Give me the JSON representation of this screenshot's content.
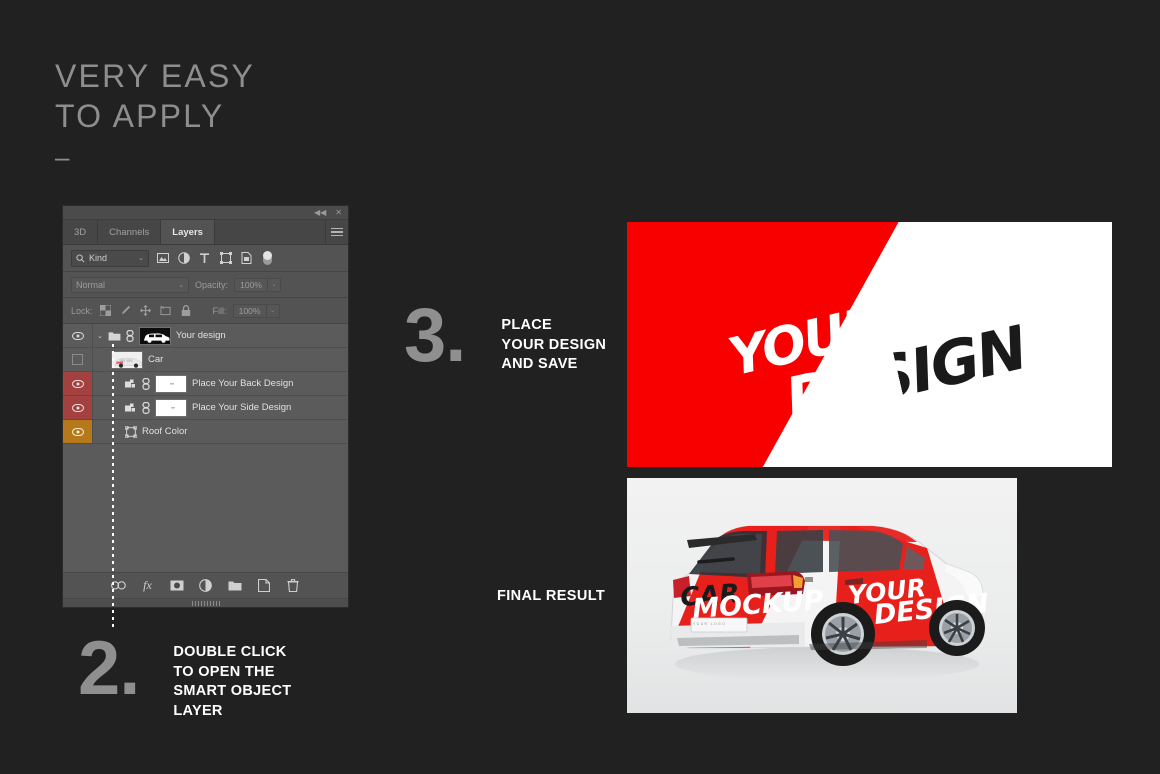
{
  "headline": {
    "line1": "VERY EASY",
    "line2": "TO APPLY",
    "dash": "–"
  },
  "photoshop_panel": {
    "titlebar": {
      "collapse": "◀◀",
      "close": "✕"
    },
    "tabs": [
      {
        "label": "3D",
        "active": false
      },
      {
        "label": "Channels",
        "active": false
      },
      {
        "label": "Layers",
        "active": true
      }
    ],
    "menu_icon": "hamburger-icon",
    "filter_row": {
      "kind_label": "Kind",
      "search_icon": "search-icon",
      "chevron": "⌄",
      "icons": [
        "image-filter-icon",
        "adjustment-filter-icon",
        "text-filter-icon",
        "shape-filter-icon",
        "smart-object-filter-icon",
        "filter-toggle-icon"
      ]
    },
    "blend_row": {
      "blend_mode": "Normal",
      "chevron": "⌄",
      "opacity_label": "Opacity:",
      "opacity_value": "100%"
    },
    "lock_row": {
      "lock_label": "Lock:",
      "icons": [
        "lock-transparent-icon",
        "lock-image-icon",
        "lock-position-icon",
        "lock-artboard-icon",
        "lock-all-icon"
      ],
      "fill_label": "Fill:",
      "fill_value": "100%"
    },
    "layers": [
      {
        "name": "Your design",
        "eye": "visible",
        "eye_style": "plain",
        "indent": 0,
        "has_chevron": true,
        "icon": "folder-icon",
        "has_link": true,
        "thumb": "car-silhouette-thumbnail"
      },
      {
        "name": "Car",
        "eye": "hidden",
        "eye_style": "empty",
        "indent": 1,
        "has_chevron": false,
        "icon": "",
        "has_link": false,
        "thumb": "car-photo-thumbnail"
      },
      {
        "name": "Place Your Back Design",
        "eye": "visible",
        "eye_style": "red",
        "indent": 2,
        "has_chevron": false,
        "icon": "smart-object-icon",
        "has_link": true,
        "thumb": "white-thumbnail"
      },
      {
        "name": "Place Your Side Design",
        "eye": "visible",
        "eye_style": "red",
        "indent": 2,
        "has_chevron": false,
        "icon": "smart-object-icon",
        "has_link": true,
        "thumb": "white-thumbnail"
      },
      {
        "name": "Roof Color",
        "eye": "visible",
        "eye_style": "orange",
        "indent": 2,
        "has_chevron": false,
        "icon": "shape-icon",
        "has_link": false,
        "thumb": ""
      }
    ],
    "bottom_toolbar": [
      "link-layers-icon",
      "layer-style-fx-icon",
      "layer-mask-icon",
      "adjustment-layer-icon",
      "new-group-icon",
      "new-layer-icon",
      "delete-layer-icon"
    ]
  },
  "steps": [
    {
      "number": "3.",
      "text": "PLACE\nYOUR DESIGN\nAND SAVE"
    },
    {
      "number": "2.",
      "text": "DOUBLE CLICK\nTO OPEN THE\nSMART OBJECT\nLAYER"
    }
  ],
  "final_result_label": "FINAL RESULT",
  "design_graphic": {
    "word1": "YOUR",
    "word2": "DESIGN",
    "red": "#f80000",
    "white": "#ffffff",
    "black": "#1a1a1a"
  },
  "car_mockup": {
    "rear_text": "CAR MOCKUP",
    "side_text_1": "YOUR",
    "side_text_2": "DESIGN",
    "plate_text": "YOUR LOGO",
    "body_red": "#e8201c",
    "body_white": "#f4f4f4"
  },
  "colors": {
    "background": "#212121",
    "headline": "#8e8e8e",
    "step_number": "#8f8f8f",
    "panel_bg": "#535353",
    "layer_bg": "#5b5b5b",
    "eye_red": "#a34040",
    "eye_orange": "#b5791b"
  }
}
